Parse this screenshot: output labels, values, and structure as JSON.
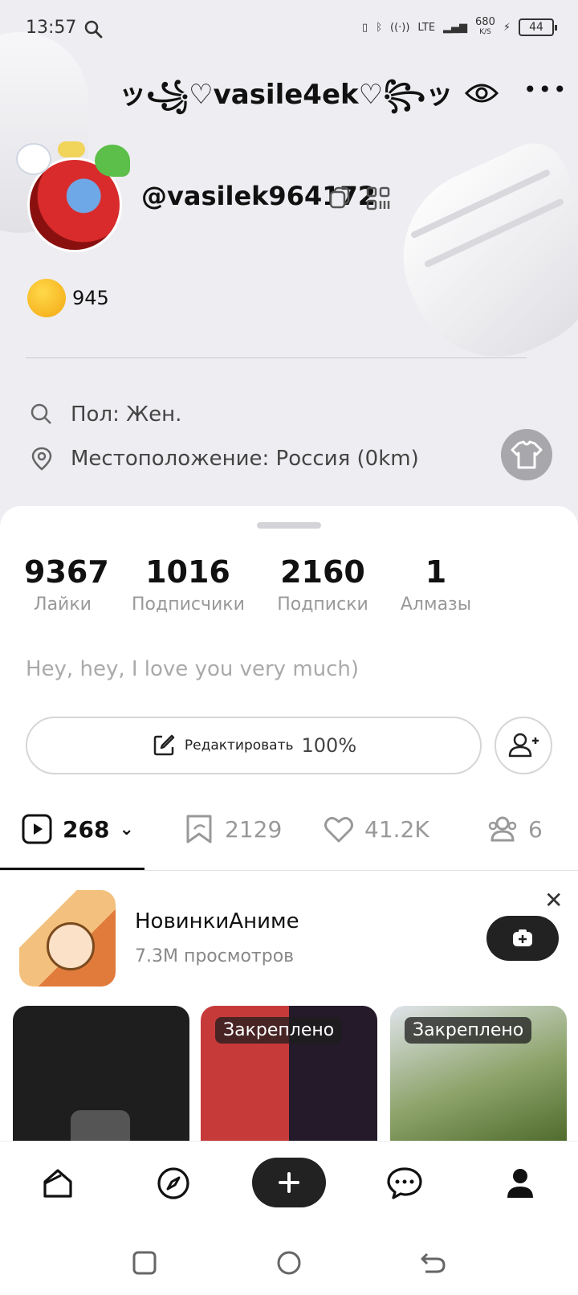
{
  "status_bar": {
    "time": "13:57",
    "network": "LTE",
    "speed_value": "680",
    "speed_unit": "K/S",
    "battery": "44"
  },
  "header": {
    "nickname": "ッ꧁♡vasile4ek♡꧂ッ"
  },
  "profile": {
    "username": "@vasilek964172",
    "coins": "945",
    "gender": "Пол: Жен.",
    "location": "Местоположение: Россия (0km)"
  },
  "stats": [
    {
      "value": "9367",
      "label": "Лайки"
    },
    {
      "value": "1016",
      "label": "Подписчики"
    },
    {
      "value": "2160",
      "label": "Подписки"
    },
    {
      "value": "1",
      "label": "Алмазы"
    }
  ],
  "bio": "Hey, hey, I love you very much)",
  "edit_button": {
    "label": "Редактировать",
    "percent": "100%"
  },
  "tabs": {
    "videos": "268",
    "reposts": "2129",
    "likes": "41.2K",
    "groups": "6"
  },
  "promo": {
    "title": "НовинкиАниме",
    "views": "7.3M просмотров"
  },
  "videos": [
    {
      "badge": ""
    },
    {
      "badge": "Закреплено"
    },
    {
      "badge": "Закреплено"
    }
  ],
  "colors": {
    "header_bg": "#eeedf1",
    "accent_dark": "#222222",
    "muted_text": "#999999"
  }
}
